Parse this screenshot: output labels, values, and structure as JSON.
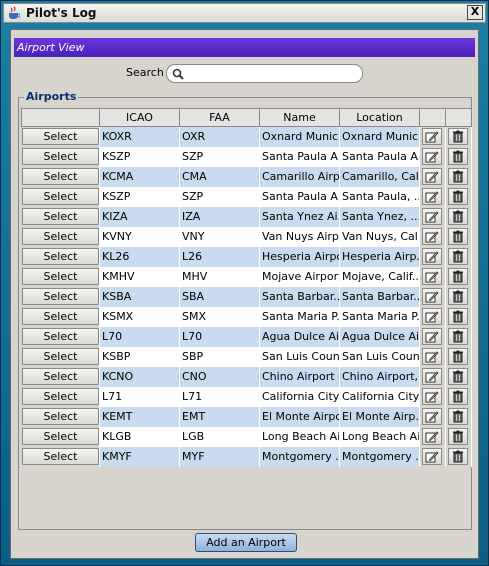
{
  "window": {
    "title": "Pilot's Log",
    "close_label": "X"
  },
  "view": {
    "header": "Airport View"
  },
  "search": {
    "label": "Search",
    "value": "",
    "placeholder": ""
  },
  "airports": {
    "legend": "Airports",
    "columns": [
      "",
      "ICAO",
      "FAA",
      "Name",
      "Location",
      "",
      ""
    ],
    "select_label": "Select",
    "rows": [
      {
        "icao": "KOXR",
        "faa": "OXR",
        "name": "Oxnard Munic...",
        "location": "Oxnard Munic..."
      },
      {
        "icao": "KSZP",
        "faa": "SZP",
        "name": "Santa Paula A...",
        "location": "Santa Paula A..."
      },
      {
        "icao": "KCMA",
        "faa": "CMA",
        "name": "Camarillo Airport",
        "location": "Camarillo, Cali..."
      },
      {
        "icao": "KSZP",
        "faa": "SZP",
        "name": "Santa Paula A...",
        "location": "Santa Paula, ..."
      },
      {
        "icao": "KIZA",
        "faa": "IZA",
        "name": "Santa Ynez Ai...",
        "location": "Santa Ynez, ..."
      },
      {
        "icao": "KVNY",
        "faa": "VNY",
        "name": "Van Nuys Airp...",
        "location": "Van Nuys, Cal..."
      },
      {
        "icao": "KL26",
        "faa": "L26",
        "name": "Hesperia Airport",
        "location": "Hesperia Airp..."
      },
      {
        "icao": "KMHV",
        "faa": "MHV",
        "name": "Mojave Airport",
        "location": "Mojave, Calif..."
      },
      {
        "icao": "KSBA",
        "faa": "SBA",
        "name": "Santa Barbar...",
        "location": "Santa Barbar..."
      },
      {
        "icao": "KSMX",
        "faa": "SMX",
        "name": "Santa Maria P...",
        "location": "Santa Maria P..."
      },
      {
        "icao": "L70",
        "faa": "L70",
        "name": "Agua Dulce Ai...",
        "location": "Agua Dulce Ai..."
      },
      {
        "icao": "KSBP",
        "faa": "SBP",
        "name": "San Luis Coun...",
        "location": "San Luis Coun..."
      },
      {
        "icao": "KCNO",
        "faa": "CNO",
        "name": "Chino Airport",
        "location": "Chino Airport,..."
      },
      {
        "icao": "L71",
        "faa": "L71",
        "name": "California City...",
        "location": "California City..."
      },
      {
        "icao": "KEMT",
        "faa": "EMT",
        "name": "El Monte Airport",
        "location": "El Monte Airp..."
      },
      {
        "icao": "KLGB",
        "faa": "LGB",
        "name": "Long Beach Ai...",
        "location": "Long Beach Ai..."
      },
      {
        "icao": "KMYF",
        "faa": "MYF",
        "name": "Montgomery ...",
        "location": "Montgomery ..."
      }
    ]
  },
  "footer": {
    "add_label": "Add an Airport"
  },
  "icons": {
    "edit": "edit-icon",
    "delete": "trash-icon",
    "search": "search-icon"
  },
  "colors": {
    "row_alt": "#c9dcef",
    "header_purple": "#5a2bcf",
    "frame": "#1b7fa3"
  }
}
